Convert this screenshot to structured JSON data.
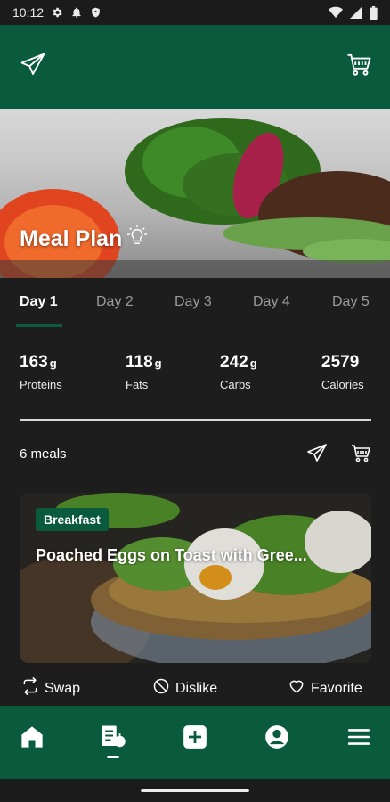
{
  "status_bar": {
    "time": "10:12"
  },
  "hero": {
    "title": "Meal Plan"
  },
  "tabs": [
    {
      "label": "Day 1",
      "active": true
    },
    {
      "label": "Day 2",
      "active": false
    },
    {
      "label": "Day 3",
      "active": false
    },
    {
      "label": "Day 4",
      "active": false
    },
    {
      "label": "Day 5",
      "active": false
    }
  ],
  "macros": [
    {
      "value": "163",
      "unit": "g",
      "label": "Proteins"
    },
    {
      "value": "118",
      "unit": "g",
      "label": "Fats"
    },
    {
      "value": "242",
      "unit": "g",
      "label": "Carbs"
    },
    {
      "value": "2579",
      "unit": "",
      "label": "Calories"
    }
  ],
  "meals": {
    "count_label": "6 meals"
  },
  "meal_card": {
    "badge": "Breakfast",
    "title": "Poached Eggs on Toast with Gree..."
  },
  "actions": {
    "swap": "Swap",
    "dislike": "Dislike",
    "favorite": "Favorite"
  },
  "colors": {
    "brand_green": "#0a5a3e",
    "background": "#1d1d1d"
  },
  "icons": {
    "app_bar_left": "send-icon",
    "app_bar_right": "cart-icon",
    "nav": [
      "home-icon",
      "meal-plan-icon",
      "add-icon",
      "profile-icon",
      "menu-icon"
    ]
  }
}
